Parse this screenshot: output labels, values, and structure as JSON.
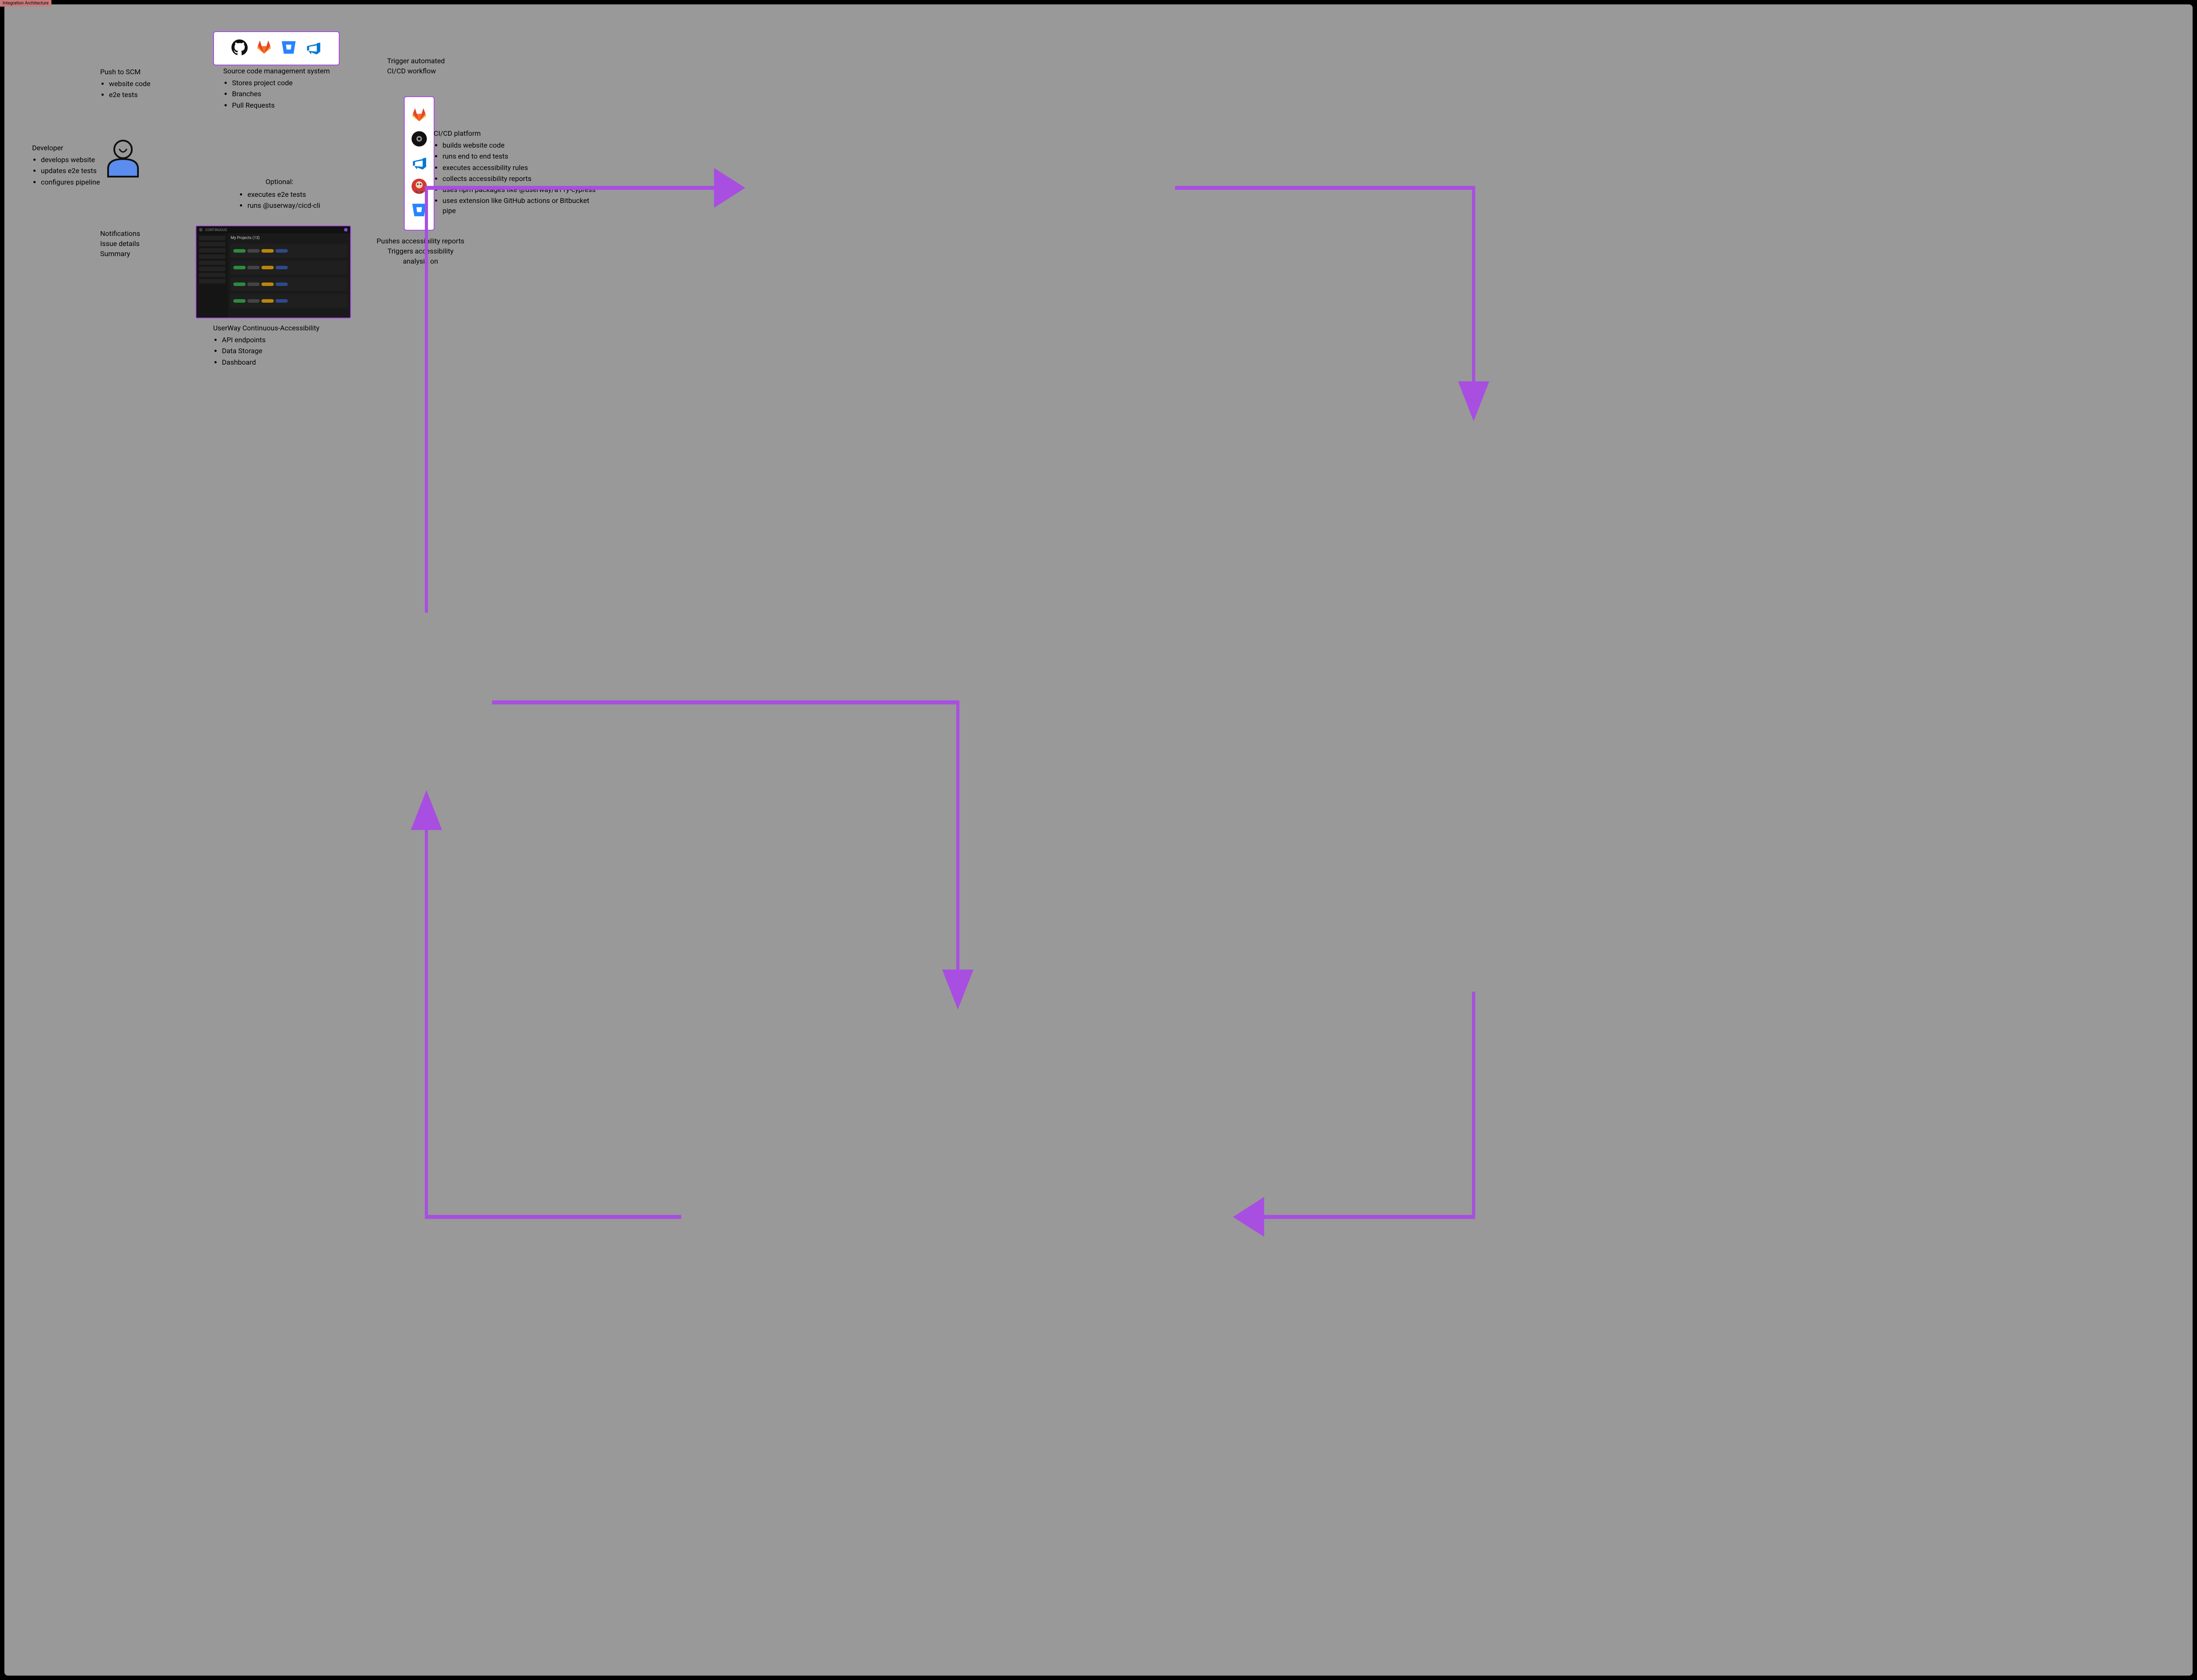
{
  "header_tab": "Integration Architecture",
  "developer": {
    "title": "Developer",
    "items": [
      "develops website",
      "updates e2e tests",
      "configures pipeline"
    ]
  },
  "push_scm": {
    "title": "Push to SCM",
    "items": [
      "website code",
      "e2e tests"
    ]
  },
  "scm": {
    "title": "Source code management system",
    "items": [
      "Stores project code",
      "Branches",
      "Pull Requests"
    ],
    "icons": [
      "github",
      "gitlab",
      "bitbucket",
      "azure-devops"
    ]
  },
  "trigger": {
    "line1": "Trigger automated",
    "line2": "CI/CD workflow"
  },
  "cicd": {
    "title": "CI/CD platform",
    "items": [
      "builds website code",
      "runs end to end tests",
      "executes accessibility rules",
      "collects accessibility reports",
      "uses npm packages like @userway/a11y-cypress",
      "uses extension like GitHub actions or Bitbucket pipe"
    ],
    "icons": [
      "gitlab",
      "circleci",
      "azure-pipelines",
      "jenkins",
      "bitbucket"
    ]
  },
  "pushes": {
    "line1": "Pushes accessibility reports",
    "line2": "Triggers accessibility",
    "line3": "analysis on"
  },
  "optional": {
    "title": "Optional:",
    "items": [
      "executes e2e tests",
      "runs @userway/cicd-cli"
    ]
  },
  "userway": {
    "title": "UserWay Continuous-Accessibility",
    "items": [
      "API endpoints",
      "Data Storage",
      "Dashboard"
    ],
    "dashboard_title": "My Projects (13)"
  },
  "notifications": {
    "line1": "Notifications",
    "line2": "Issue details",
    "line3": "Summary"
  }
}
